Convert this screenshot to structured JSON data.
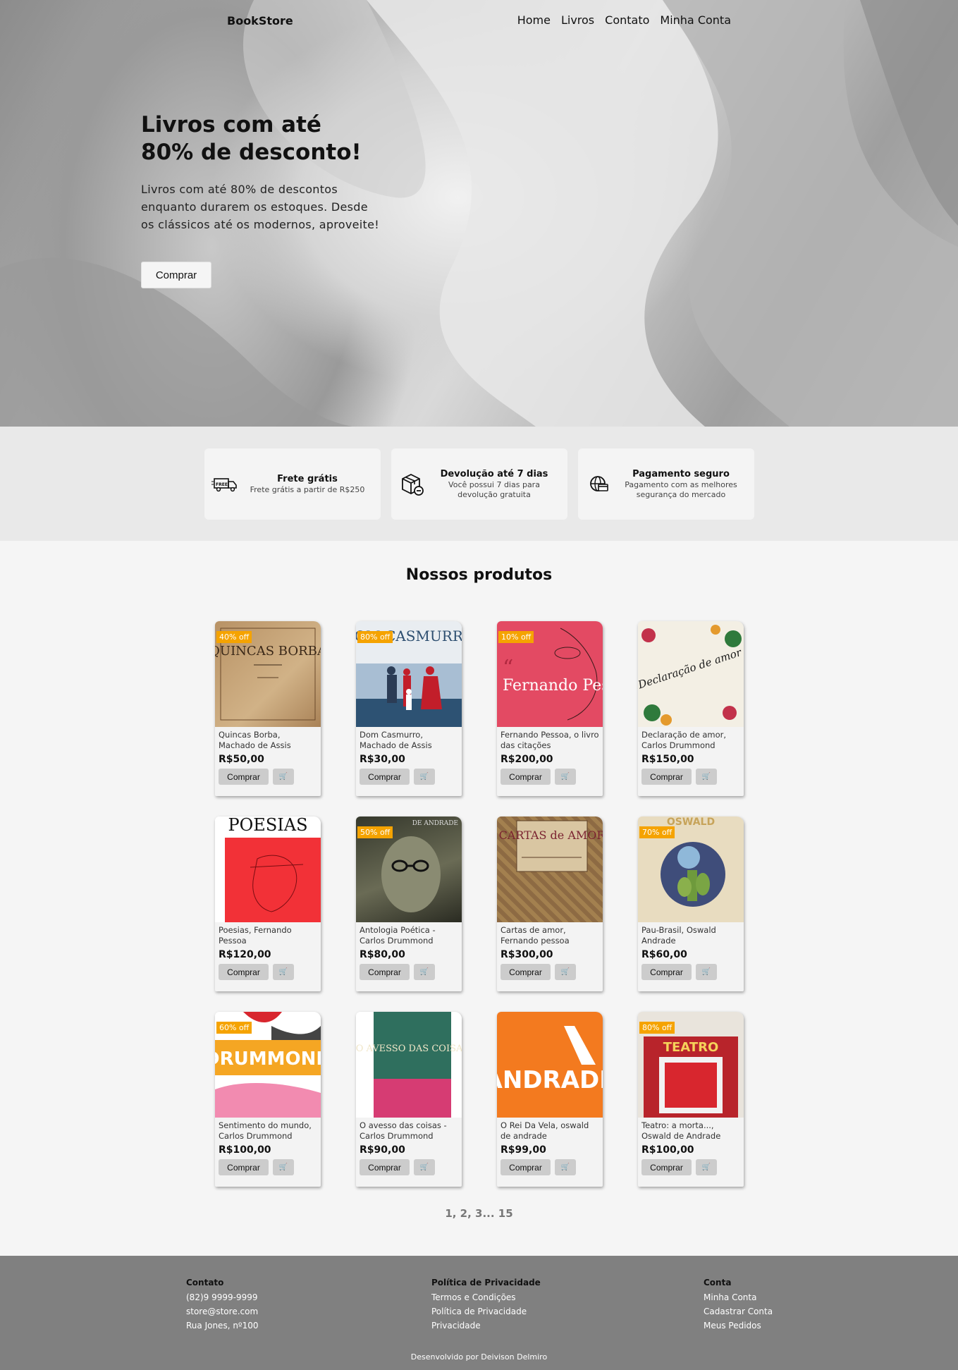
{
  "nav": {
    "brand": "BookStore",
    "items": [
      "Home",
      "Livros",
      "Contato",
      "Minha Conta"
    ]
  },
  "hero": {
    "title": "Livros com até 80% de desconto!",
    "text": "Livros com até 80% de descontos enquanto durarem os estoques. Desde os clássicos até os modernos, aproveite!",
    "button": "Comprar"
  },
  "features": [
    {
      "icon": "truck-free-icon",
      "title": "Frete grátis",
      "desc": "Frete grátis a partir de R$250"
    },
    {
      "icon": "box-return-icon",
      "title": "Devolução até 7 dias",
      "desc": "Você possui 7 dias para devolução gratuita"
    },
    {
      "icon": "secure-payment-icon",
      "title": "Pagamento seguro",
      "desc": "Pagamento com as melhores segurança do mercado"
    }
  ],
  "products": {
    "title": "Nossos produtos",
    "buy_label": "Comprar",
    "items": [
      {
        "name": "Quincas Borba, Machado de Assis",
        "price": "R$50,00",
        "badge": "40% off",
        "cover_text": "QUINCAS BORBA"
      },
      {
        "name": "Dom Casmurro, Machado de Assis",
        "price": "R$30,00",
        "badge": "80% off",
        "cover_text": "DOM CASMURRO"
      },
      {
        "name": "Fernando Pessoa, o livro das citações",
        "price": "R$200,00",
        "badge": "10% off",
        "cover_text": "Fernando Pessoa"
      },
      {
        "name": "Declaração de amor, Carlos Drummond",
        "price": "R$150,00",
        "badge": "",
        "cover_text": "Declaração de amor"
      },
      {
        "name": "Poesias, Fernando Pessoa",
        "price": "R$120,00",
        "badge": "",
        "cover_text": "POESIAS"
      },
      {
        "name": "Antologia Poética - Carlos Drummond",
        "price": "R$80,00",
        "badge": "50% off",
        "cover_text": "DE ANDRADE"
      },
      {
        "name": "Cartas de amor, Fernando pessoa",
        "price": "R$300,00",
        "badge": "",
        "cover_text": "CARTAS de AMOR"
      },
      {
        "name": "Pau-Brasil, Oswald Andrade",
        "price": "R$60,00",
        "badge": "70% off",
        "cover_text": "OSWALD"
      },
      {
        "name": "Sentimento do mundo, Carlos Drummond",
        "price": "R$100,00",
        "badge": "60% off",
        "cover_text": "DRUMMOND"
      },
      {
        "name": "O avesso das coisas - Carlos Drummond",
        "price": "R$90,00",
        "badge": "",
        "cover_text": "O AVESSO DAS COISAS"
      },
      {
        "name": "O Rei Da Vela, oswald de andrade",
        "price": "R$99,00",
        "badge": "",
        "cover_text": "ANDRADE"
      },
      {
        "name": "Teatro: a morta..., Oswald de Andrade",
        "price": "R$100,00",
        "badge": "80% off",
        "cover_text": "TEATRO"
      }
    ],
    "pagination": "1, 2, 3... 15"
  },
  "footer": {
    "columns": [
      {
        "title": "Contato",
        "links": [
          "(82)9 9999-9999",
          "store@store.com",
          "Rua Jones, nº100"
        ]
      },
      {
        "title": "Política de Privacidade",
        "links": [
          "Termos e Condições",
          "Política de Privacidade",
          "Privacidade"
        ]
      },
      {
        "title": "Conta",
        "links": [
          "Minha Conta",
          "Cadastrar Conta",
          "Meus Pedidos"
        ]
      }
    ],
    "credit": "Desenvolvido por Deivison Delmiro"
  }
}
